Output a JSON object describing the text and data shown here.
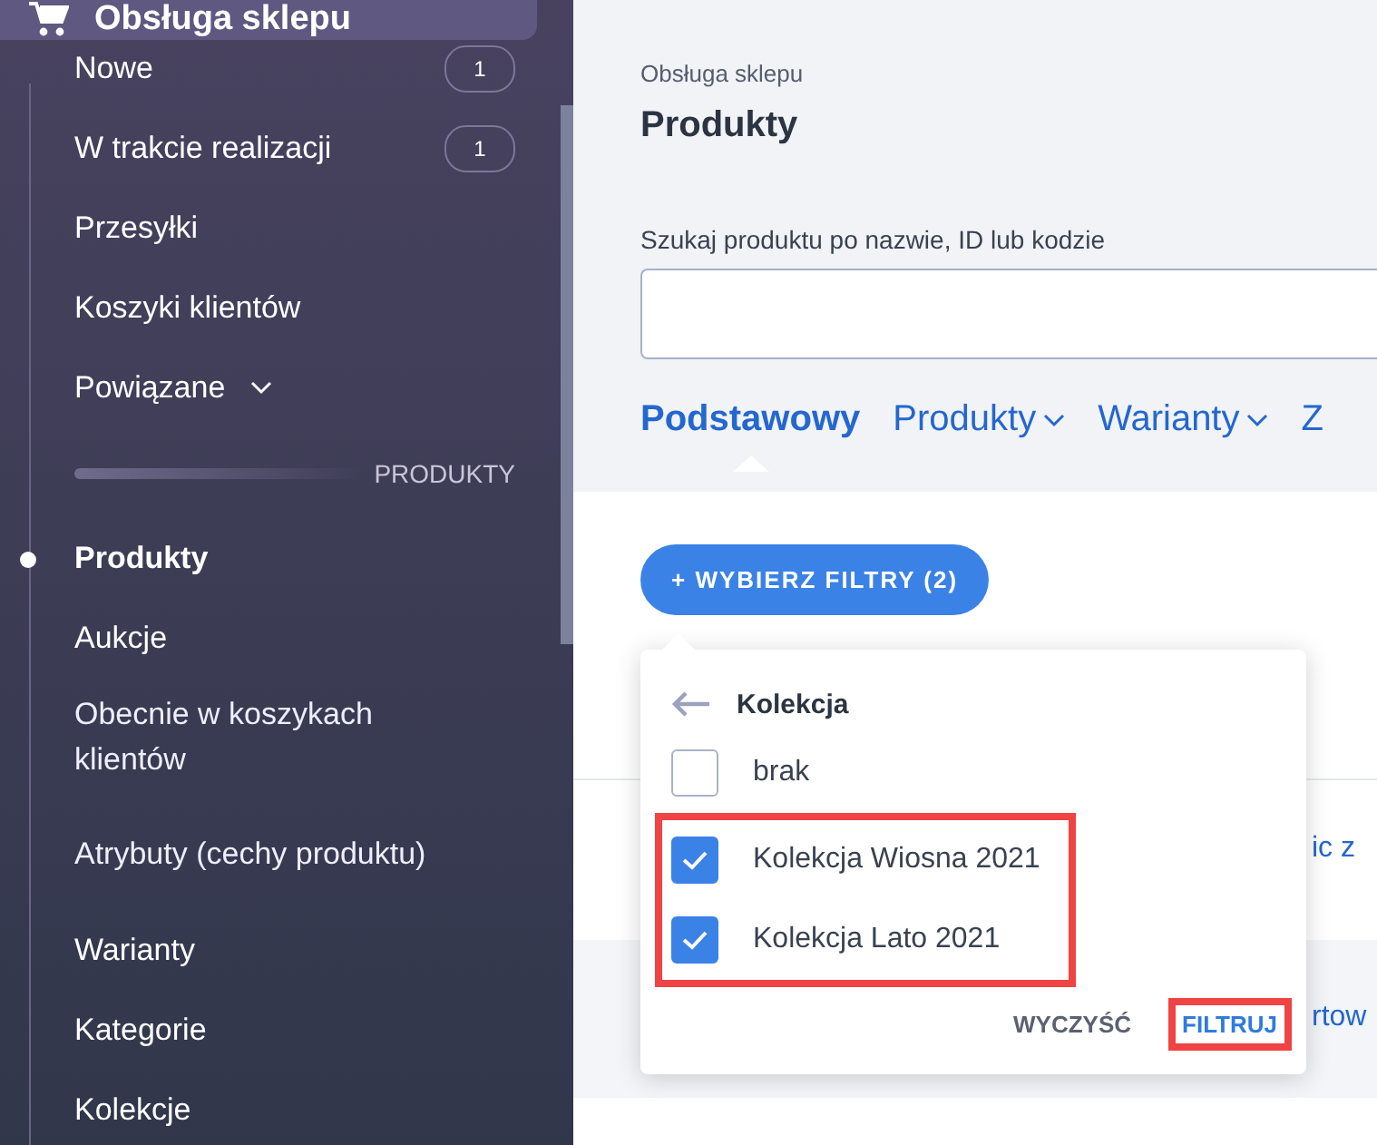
{
  "sidebar": {
    "header": {
      "title": "Obsługa sklepu"
    },
    "items": [
      {
        "kind": "link",
        "label": "Nowe",
        "badge": "1",
        "selected": false
      },
      {
        "kind": "link",
        "label": "W trakcie realizacji",
        "badge": "1",
        "selected": false
      },
      {
        "kind": "link",
        "label": "Przesyłki",
        "selected": false
      },
      {
        "kind": "link",
        "label": "Koszyki klientów",
        "selected": false
      },
      {
        "kind": "expander",
        "label": "Powiązane",
        "expanded": false
      },
      {
        "kind": "section",
        "label": "PRODUKTY"
      },
      {
        "kind": "link",
        "label": "Produkty",
        "selected": true
      },
      {
        "kind": "link",
        "label": "Aukcje",
        "selected": false
      },
      {
        "kind": "link",
        "label": "Obecnie w koszykach klientów",
        "selected": false
      },
      {
        "kind": "link",
        "label": "Atrybuty (cechy produktu)",
        "selected": false
      },
      {
        "kind": "link",
        "label": "Warianty",
        "selected": false
      },
      {
        "kind": "link",
        "label": "Kategorie",
        "selected": false
      },
      {
        "kind": "link",
        "label": "Kolekcje",
        "selected": false
      }
    ]
  },
  "main": {
    "breadcrumb": "Obsługa sklepu",
    "title": "Produkty",
    "search": {
      "label": "Szukaj produktu po nazwie, ID lub kodzie"
    },
    "tabs": [
      {
        "label": "Podstawowy",
        "selected": true,
        "dropdown": false
      },
      {
        "label": "Produkty",
        "selected": false,
        "dropdown": true
      },
      {
        "label": "Warianty",
        "selected": false,
        "dropdown": true
      },
      {
        "label": "Z",
        "selected": false,
        "dropdown": false
      }
    ],
    "filter_button": "+ WYBIERZ FILTRY (2)",
    "background_texts": [
      "ic z",
      "rtow"
    ],
    "popup": {
      "title": "Kolekcja",
      "options": [
        {
          "label": "brak",
          "checked": false,
          "highlighted": false
        },
        {
          "label": "Kolekcja Wiosna 2021",
          "checked": true,
          "highlighted": true
        },
        {
          "label": "Kolekcja Lato 2021",
          "checked": true,
          "highlighted": true
        }
      ],
      "actions": [
        {
          "label": "WYCZYŚĆ",
          "highlighted": false
        },
        {
          "label": "FILTRUJ",
          "highlighted": true
        }
      ]
    }
  }
}
